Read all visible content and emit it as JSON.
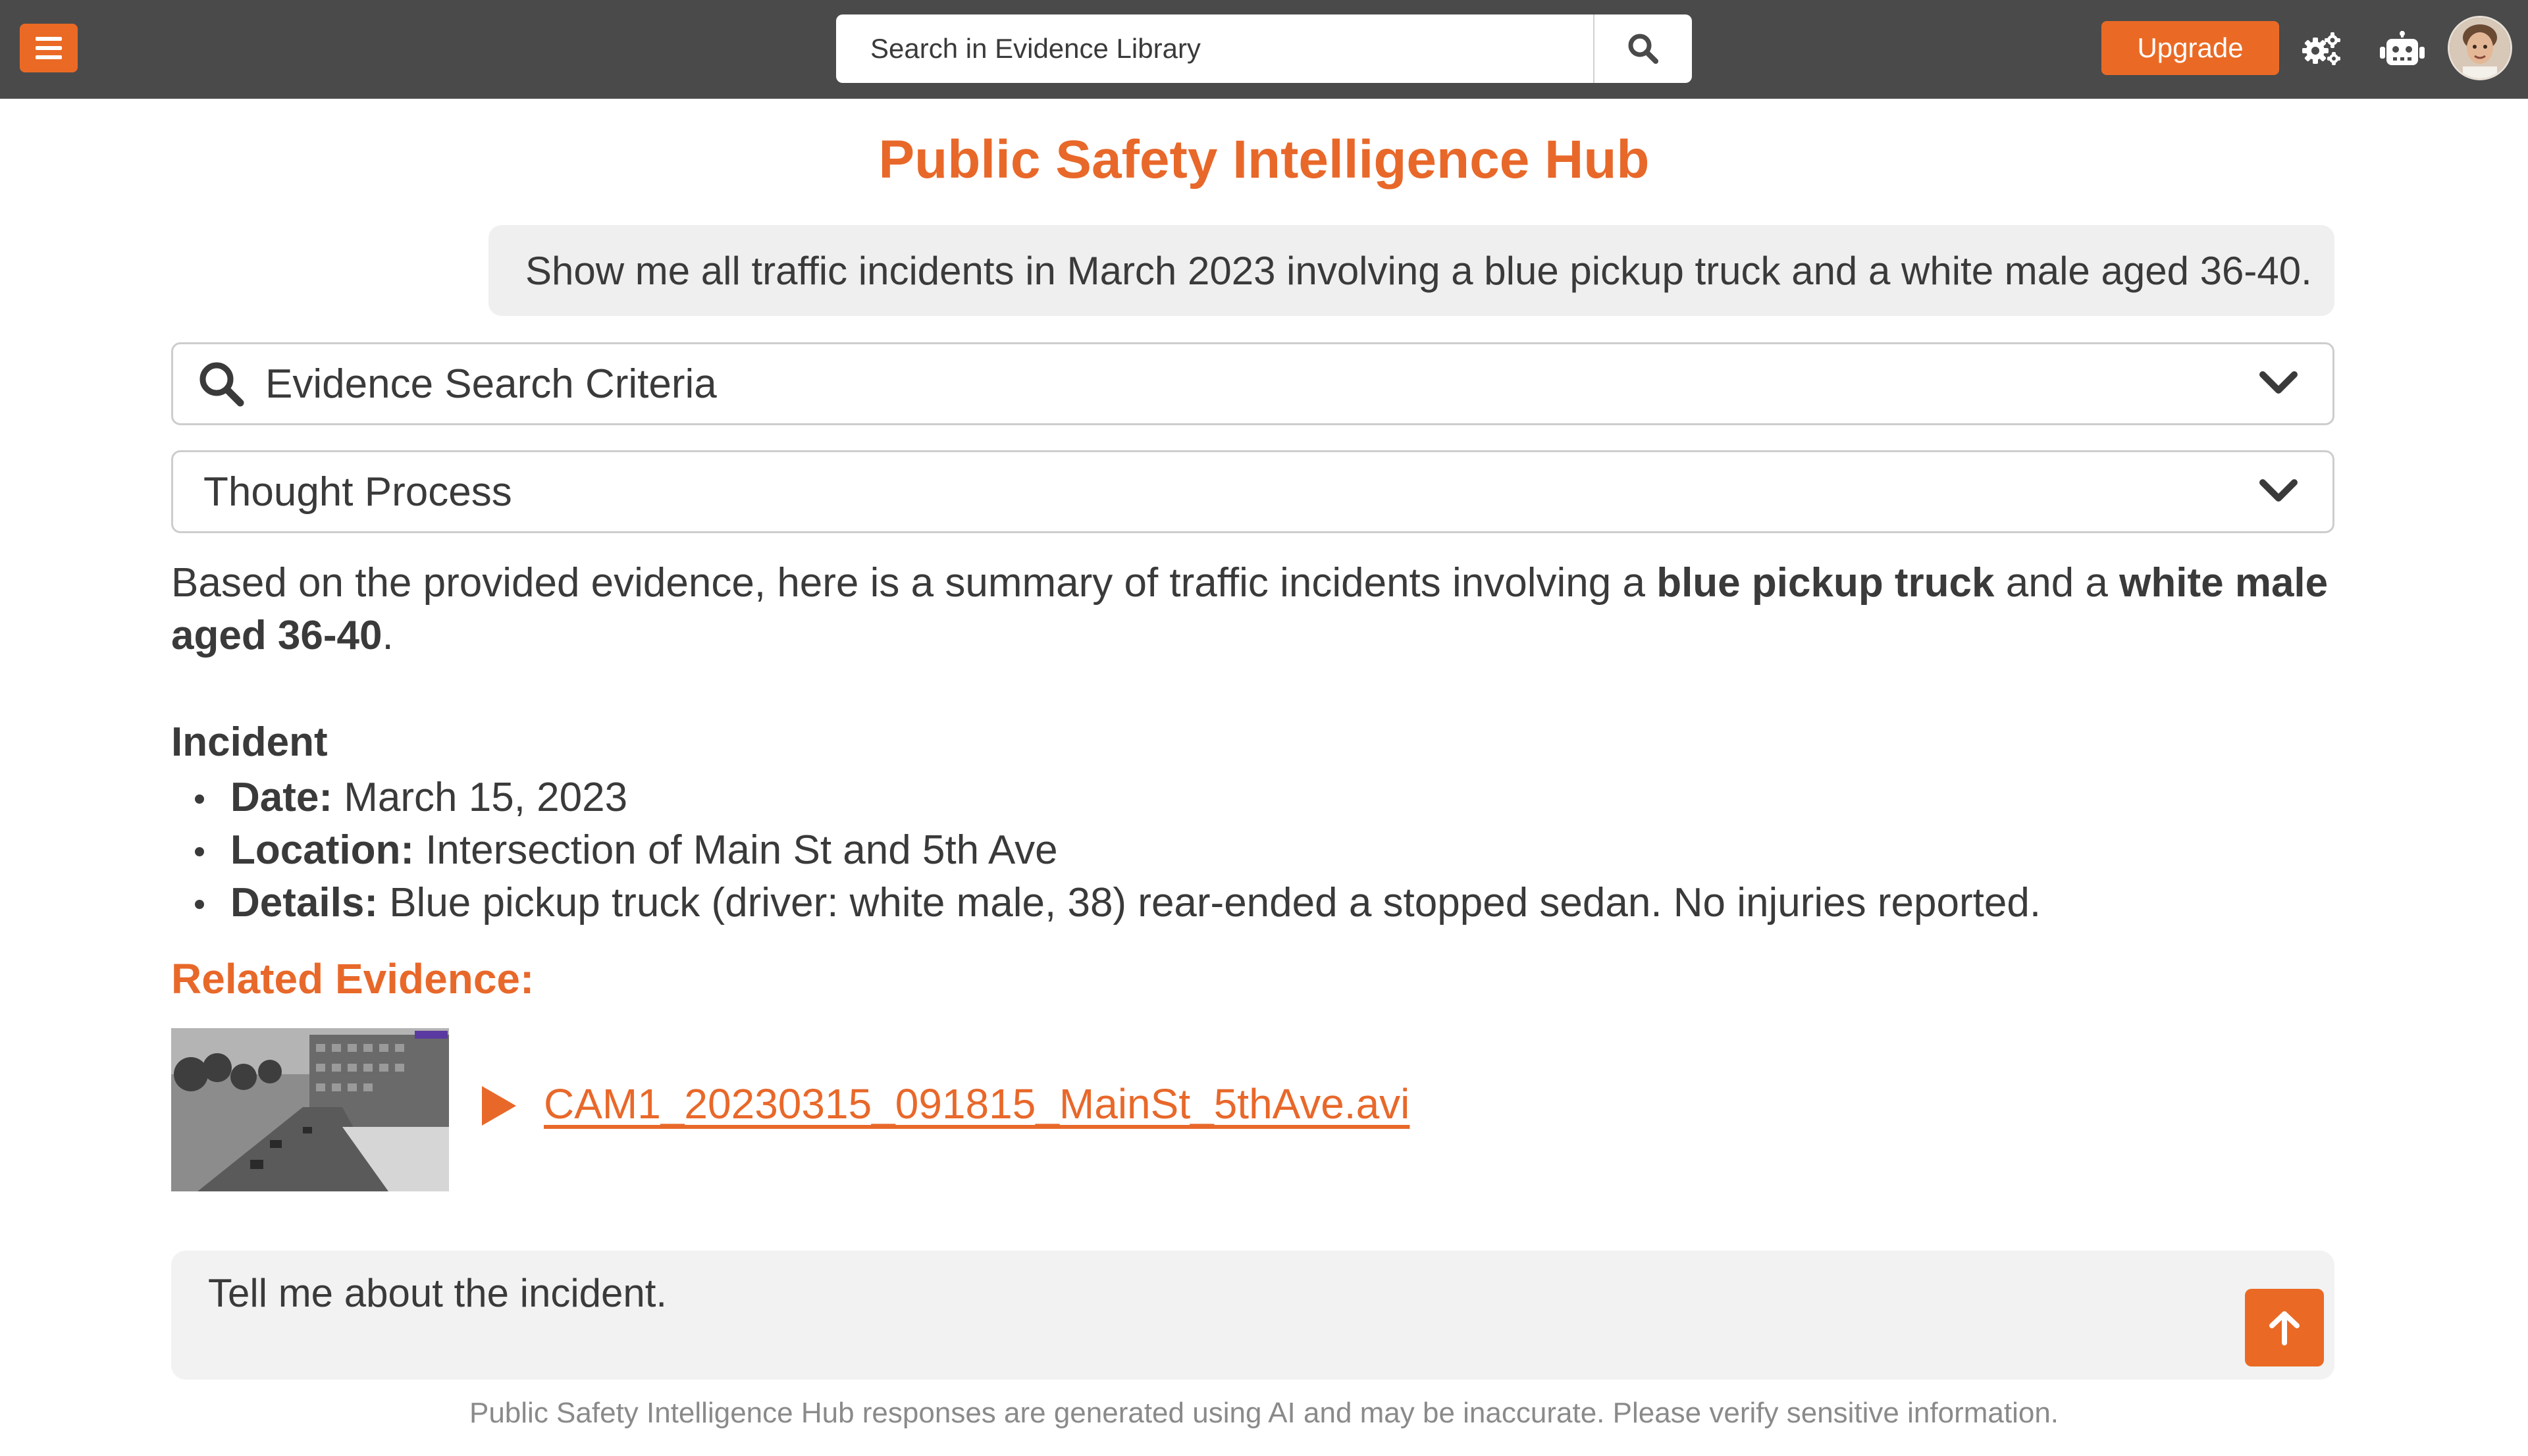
{
  "header": {
    "search_placeholder": "Search in Evidence Library",
    "upgrade_label": "Upgrade",
    "accent_color": "#ea6a25",
    "bar_color": "#4a4a4a",
    "icons": [
      "menu-icon",
      "search-icon",
      "settings-gears-icon",
      "robot-icon",
      "user-avatar"
    ]
  },
  "page_title": "Public Safety Intelligence Hub",
  "user_query": "Show me all traffic incidents in March 2023 involving a blue pickup truck and a white male aged 36-40.",
  "accordions": [
    {
      "label": "Evidence Search Criteria",
      "icon": "search-icon",
      "expanded": false
    },
    {
      "label": "Thought Process",
      "expanded": false
    }
  ],
  "response": {
    "intro_prefix": "Based on the provided evidence, here is a summary of traffic incidents involving a ",
    "intro_bold_1": "blue pickup truck",
    "intro_middle": " and a ",
    "intro_bold_2": "white male aged 36-40",
    "intro_suffix": ".",
    "incident_heading": "Incident",
    "details": [
      {
        "label": "Date:",
        "value": " March 15, 2023"
      },
      {
        "label": "Location:",
        "value": " Intersection of Main St and 5th Ave"
      },
      {
        "label": "Details:",
        "value": " Blue pickup truck (driver: white male, 38) rear-ended a stopped sedan. No injuries reported."
      }
    ],
    "related_heading": "Related Evidence:",
    "evidence_file": "CAM1_20230315_091815_MainSt_5thAve.avi"
  },
  "chat_input": {
    "placeholder": "Tell me about the incident."
  },
  "disclaimer": "Public Safety Intelligence Hub responses are generated using AI and may be inaccurate. Please verify sensitive information."
}
